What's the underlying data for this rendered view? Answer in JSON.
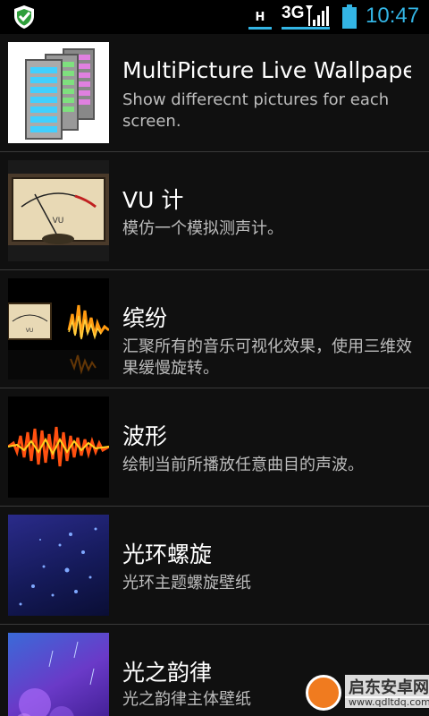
{
  "status_bar": {
    "network_h": "H",
    "network_3g": "3G",
    "time": "10:47",
    "colors": {
      "accent": "#33b5e5"
    },
    "icons": [
      "shield-icon",
      "signal-icon",
      "battery-icon"
    ]
  },
  "items": [
    {
      "title": "MultiPicture Live Wallpaper",
      "desc": "Show differecnt pictures for each screen.",
      "thumb_icon": "multipicture-icon"
    },
    {
      "title": "VU 计",
      "desc": "模仿一个模拟测声计。",
      "thumb_icon": "vu-meter-icon"
    },
    {
      "title": "缤纷",
      "desc": "汇聚所有的音乐可视化效果，使用三维效果缓慢旋转。",
      "thumb_icon": "visualizer-icon"
    },
    {
      "title": "波形",
      "desc": "绘制当前所播放任意曲目的声波。",
      "thumb_icon": "waveform-icon"
    },
    {
      "title": "光环螺旋",
      "desc": "光环主题螺旋壁纸",
      "thumb_icon": "spiral-icon"
    },
    {
      "title": "光之韵律",
      "desc": "光之韵律主体壁纸",
      "thumb_icon": "rhythm-icon"
    }
  ],
  "watermark": {
    "line1": "启东安卓网",
    "line2": "www.qdltdq.com"
  }
}
